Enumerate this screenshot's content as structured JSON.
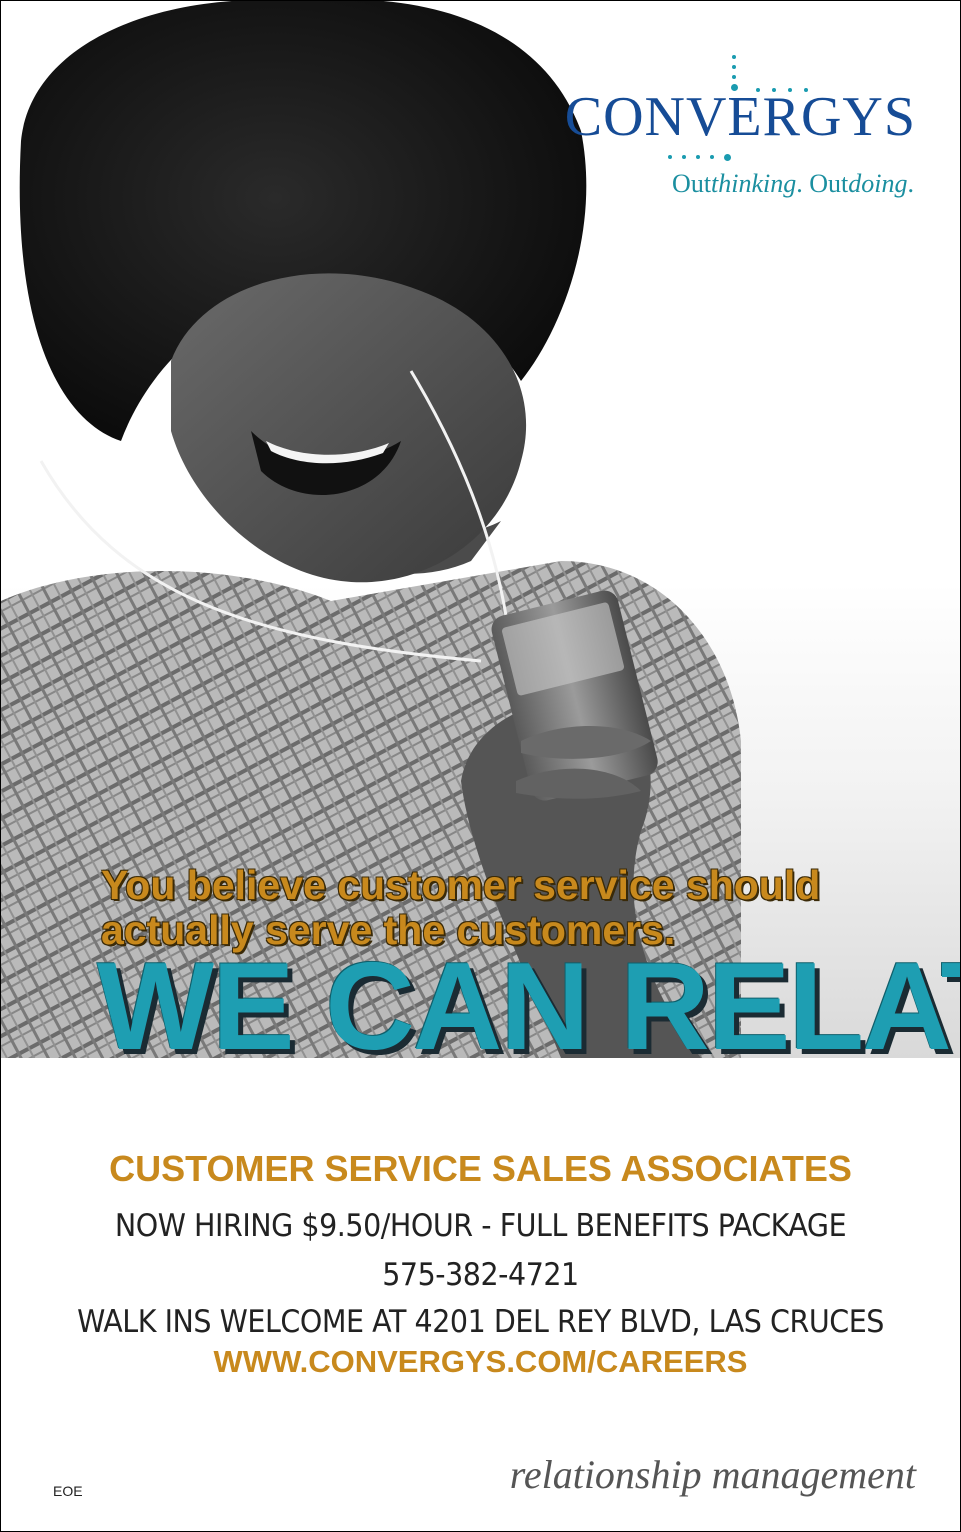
{
  "logo": {
    "wordmark": "CONVERGYS",
    "tagline_parts": [
      "Out",
      "thinking",
      ". Out",
      "doing",
      "."
    ]
  },
  "ad": {
    "tagline_line1": "You believe customer service should",
    "tagline_line2": "actually serve the customers.",
    "headline": "WE CAN RELATE.",
    "job_title": "CUSTOMER SERVICE SALES ASSOCIATES",
    "line1": "NOW HIRING $9.50/HOUR - FULL BENEFITS PACKAGE",
    "phone": "575-382-4721",
    "line3": "WALK INS WELCOME AT 4201 DEL REY BLVD, LAS CRUCES",
    "url": "WWW.CONVERGYS.COM/CAREERS",
    "eoe": "EOE",
    "footer_tagline": "relationship management"
  },
  "colors": {
    "brand_blue": "#164c96",
    "teal": "#1e9eb2",
    "gold": "#c8891d"
  }
}
